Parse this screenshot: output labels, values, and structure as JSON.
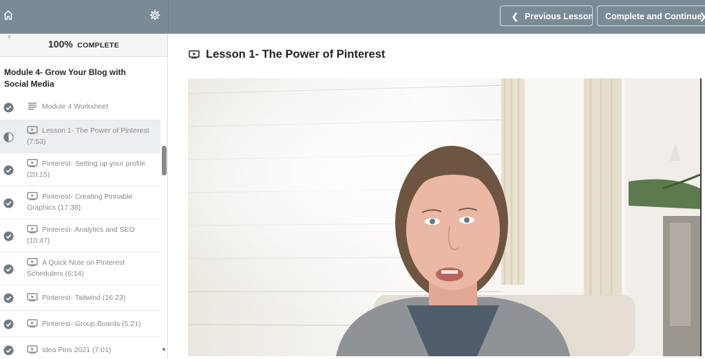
{
  "topbar": {
    "home_icon": "home-icon",
    "settings_icon": "gear-icon",
    "prev_label": "Previous Lesson",
    "next_label": "Complete and Continue",
    "bg_color": "#7b8b95"
  },
  "sidebar": {
    "progress_percent": "100%",
    "progress_label": "COMPLETE",
    "module_title": "Module 4- Grow Your Blog with Social Media",
    "lessons": [
      {
        "title": "Module 4 Worksheet",
        "icon": "text-lines-icon",
        "status": "completed"
      },
      {
        "title": "Lesson 1- The Power of Pinterest (7:53)",
        "icon": "video-icon",
        "status": "in-progress",
        "active": true
      },
      {
        "title": "Pinterest- Setting up your profile (20:15)",
        "icon": "video-icon",
        "status": "completed"
      },
      {
        "title": "Pinterest- Creating Pinnable Graphics (17:38)",
        "icon": "video-icon",
        "status": "completed"
      },
      {
        "title": "Pinterest- Analytics and SEO (10:47)",
        "icon": "video-icon",
        "status": "completed"
      },
      {
        "title": "A Quick Note on Pinterest Schedulers (6:14)",
        "icon": "video-icon",
        "status": "completed"
      },
      {
        "title": "Pinterest- Tailwind (16:23)",
        "icon": "video-icon",
        "status": "completed"
      },
      {
        "title": "Pinterest- Group Boards (5:21)",
        "icon": "video-icon",
        "status": "completed"
      },
      {
        "title": "Idea Pins 2021 (7:01)",
        "icon": "video-icon",
        "status": "completed"
      }
    ]
  },
  "main": {
    "lesson_title": "Lesson 1- The Power of Pinterest",
    "lesson_icon": "video-icon",
    "video_description_icon": "video-player"
  }
}
